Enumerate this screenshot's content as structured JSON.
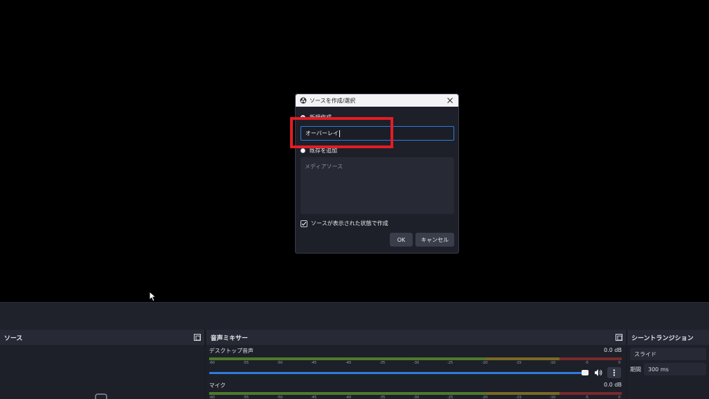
{
  "dialog": {
    "title": "ソースを作成/選択",
    "create_new_label": "新規作成",
    "name_value": "オーバーレイ",
    "add_existing_label": "既存を追加",
    "existing_list_item": "メディアソース",
    "visible_checkbox_label": "ソースが表示された状態で作成",
    "ok_label": "OK",
    "cancel_label": "キャンセル"
  },
  "docks": {
    "sources_title": "ソース",
    "mixer_title": "音声ミキサー",
    "transitions_title": "シーントランジション"
  },
  "mixer": {
    "scale": [
      "-60",
      "-55",
      "-50",
      "-45",
      "-40",
      "-35",
      "-30",
      "-25",
      "-20",
      "-15",
      "-10",
      "-5",
      "0"
    ],
    "channels": [
      {
        "name": "デスクトップ音声",
        "level": "0.0 dB"
      },
      {
        "name": "マイク",
        "level": "0.0 dB"
      }
    ]
  },
  "transitions": {
    "selected": "スライド",
    "duration_label": "期間",
    "duration_value": "300 ms"
  },
  "colors": {
    "accent": "#2f7be0",
    "highlight": "#e51c23"
  }
}
